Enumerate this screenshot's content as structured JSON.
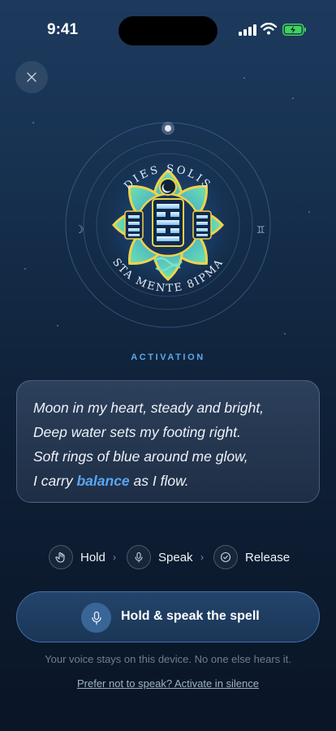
{
  "status_bar": {
    "time": "9:41"
  },
  "close_icon": "close-icon",
  "emblem": {
    "top_text": "DIES SOLIS",
    "bottom_text": "STA MENTE 8IPMA",
    "left_glyph": "☽",
    "right_glyph": "♊"
  },
  "section_label": "ACTIVATION",
  "verse": {
    "line1": "Moon in my heart, steady and bright,",
    "line2": "Deep water sets my footing right.",
    "line3": "Soft rings of blue around me glow,",
    "line4_before": "I carry ",
    "line4_highlight": "balance",
    "line4_after": " as I flow."
  },
  "steps": [
    {
      "label": "Hold",
      "icon": "hand-icon"
    },
    {
      "label": "Speak",
      "icon": "mic-icon"
    },
    {
      "label": "Release",
      "icon": "check-icon"
    }
  ],
  "primary_button": {
    "label": "Hold & speak the spell",
    "icon": "mic-icon"
  },
  "privacy_note": "Your voice stays on this device. No one else hears it.",
  "silent_link": "Prefer not to speak? Activate in silence",
  "colors": {
    "accent": "#5aa6f0",
    "button_border": "#3f6fa8",
    "background": "#0f2138"
  }
}
